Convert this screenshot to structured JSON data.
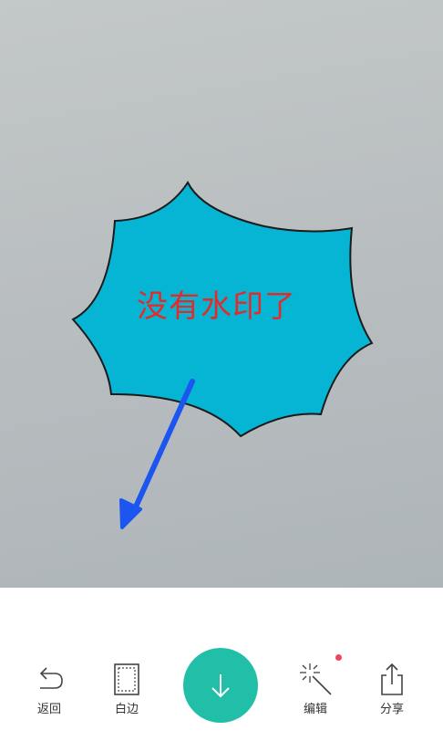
{
  "photo": {
    "burst_text": "没有水印了",
    "burst_fill": "#06b4d4",
    "arrow_color": "#1c55f0"
  },
  "toolbar": {
    "back_label": "返回",
    "border_label": "白边",
    "edit_label": "编辑",
    "share_label": "分享",
    "save_icon": "download-arrow-icon",
    "accent_color": "#21bfa8",
    "badge_color": "#f0455c"
  }
}
